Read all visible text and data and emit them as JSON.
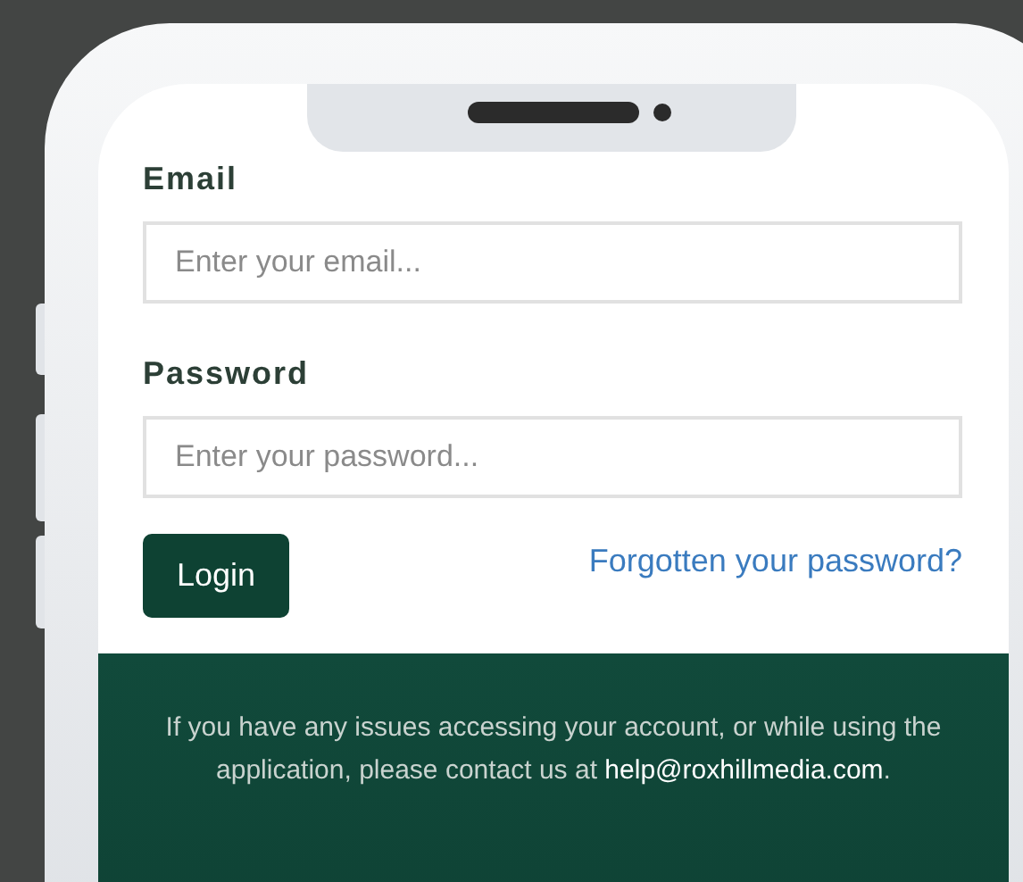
{
  "form": {
    "fields": [
      {
        "label": "Email",
        "placeholder": "Enter your email..."
      },
      {
        "label": "Password",
        "placeholder": "Enter your password..."
      }
    ],
    "login_button": "Login",
    "forgot_link": "Forgotten your password?"
  },
  "footer": {
    "text": "If you have any issues accessing your account, or while using the application, please contact us at",
    "email": "help@roxhillmedia.com",
    "end": "."
  }
}
